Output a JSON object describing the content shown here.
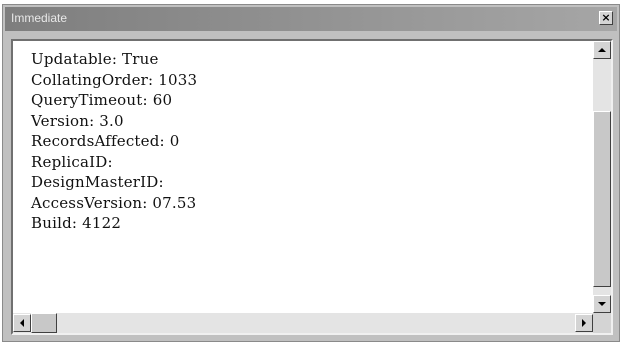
{
  "window": {
    "title": "Immediate",
    "close_glyph": "×"
  },
  "output_lines": [
    "Updatable: True",
    "CollatingOrder: 1033",
    "QueryTimeout: 60",
    "Version: 3.0",
    "RecordsAffected: 0",
    "ReplicaID:",
    "DesignMasterID:",
    "AccessVersion: 07.53",
    "Build: 4122"
  ],
  "icons": {
    "close": "close-icon",
    "scroll_up": "arrow-up-icon",
    "scroll_down": "arrow-down-icon",
    "scroll_left": "arrow-left-icon",
    "scroll_right": "arrow-right-icon"
  },
  "colors": {
    "title_bar": "#8e8e8e",
    "window_face": "#c0c0c0",
    "text_background": "#ffffff"
  }
}
